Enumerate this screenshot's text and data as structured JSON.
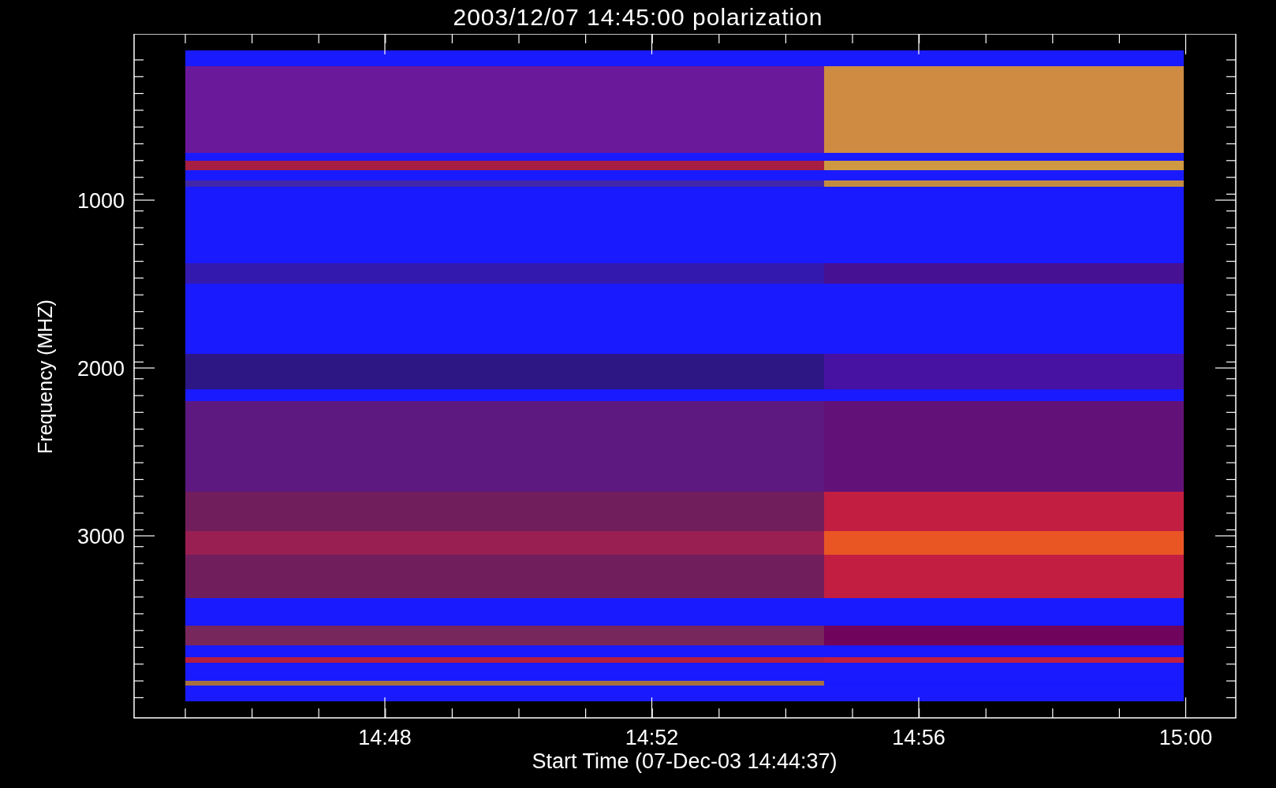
{
  "title": "2003/12/07 14:45:00 polarization",
  "y_axis": {
    "label": "Frequency (MHZ)",
    "ticks": [
      "1000",
      "2000",
      "3000"
    ]
  },
  "x_axis": {
    "label": "Start Time (07-Dec-03 14:44:37)",
    "ticks": [
      "14:48",
      "14:52",
      "14:56",
      "15:00"
    ]
  }
}
